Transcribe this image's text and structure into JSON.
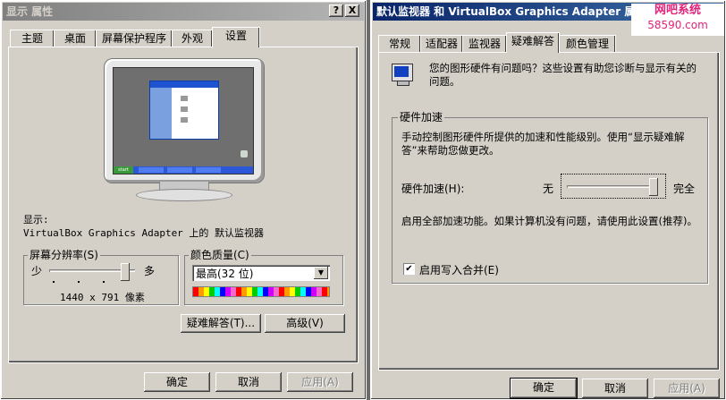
{
  "left_window": {
    "title": "显示 属性",
    "tabs": [
      "主题",
      "桌面",
      "屏幕保护程序",
      "外观",
      "设置"
    ],
    "selected_tab": "设置",
    "display_label": "显示:",
    "display_device": "VirtualBox Graphics Adapter 上的 默认监视器",
    "resolution_group": "屏幕分辨率(S)",
    "res_less": "少",
    "res_more": "多",
    "resolution": "1440 x 791 像素",
    "color_group": "颜色质量(C)",
    "color_value": "最高(32 位)",
    "troubleshoot_button": "疑难解答(T)...",
    "advanced_button": "高级(V)",
    "ok": "确定",
    "cancel": "取消",
    "apply": "应用(A)"
  },
  "right_window": {
    "title": "默认监视器 和 VirtualBox Graphics Adapter 属性",
    "tabs": [
      "常规",
      "适配器",
      "监视器",
      "疑难解答",
      "颜色管理"
    ],
    "selected_tab": "疑难解答",
    "intro": "您的图形硬件有问题吗？这些设置有助您诊断与显示有关的问题。",
    "accel_group": "硬件加速",
    "accel_desc": "手动控制图形硬件所提供的加速和性能级别。使用“显示疑难解答”来帮助您做更改。",
    "accel_label": "硬件加速(H):",
    "accel_none": "无",
    "accel_full": "完全",
    "accel_level_percent": 100,
    "accel_status": "启用全部加速功能。如果计算机没有问题，请使用此设置(推荐)。",
    "write_combining_label": "启用写入合并(E)",
    "write_combining_checked": true,
    "ok": "确定",
    "cancel": "取消",
    "apply": "应用(A)"
  },
  "watermark": {
    "top": "网吧系统",
    "bottom": "58590.com"
  },
  "title_buttons": {
    "help": "?",
    "close": "X"
  },
  "mini_screen": {
    "start": "start"
  },
  "icons": [
    "monitor-icon",
    "help-icon",
    "close-icon",
    "dropdown-arrow-icon",
    "checkbox-icon"
  ]
}
